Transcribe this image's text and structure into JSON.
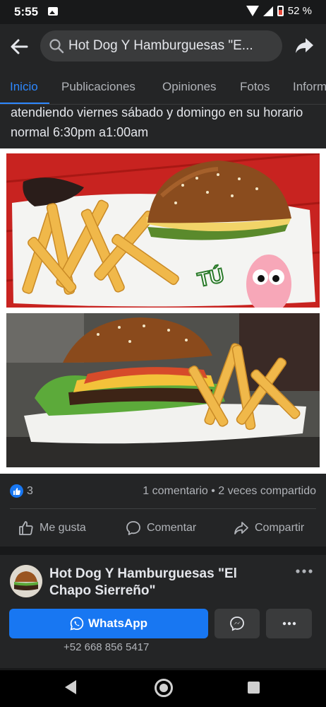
{
  "status_bar": {
    "time": "5:55",
    "battery": "52 %"
  },
  "header": {
    "search_text": "Hot Dog Y Hamburguesas \"E..."
  },
  "tabs": [
    {
      "label": "Inicio",
      "active": true
    },
    {
      "label": "Publicaciones",
      "active": false
    },
    {
      "label": "Opiniones",
      "active": false
    },
    {
      "label": "Fotos",
      "active": false
    },
    {
      "label": "Inform",
      "active": false
    }
  ],
  "post": {
    "text": "atendiendo viernes sábado y domingo en su horario normal 6:30pm a1:00am",
    "photo_1_caption": "TÚ",
    "reaction_count": "3",
    "engagement": "1 comentario • 2 veces compartido"
  },
  "actions": {
    "like": "Me gusta",
    "comment": "Comentar",
    "share": "Compartir"
  },
  "page_card": {
    "name": "Hot Dog Y Hamburguesas \"El Chapo Sierreño\"",
    "whatsapp_label": "WhatsApp",
    "phone": "+52 668 856 5417"
  },
  "colors": {
    "accent": "#2d88ff",
    "button_primary": "#1877f2",
    "background": "#242526",
    "photo_tray_red": "#c41f1c"
  },
  "icons": [
    "back-arrow-icon",
    "search-icon",
    "share-arrow-icon",
    "like-thumb-icon",
    "comment-bubble-icon",
    "share-icon",
    "whatsapp-icon",
    "messenger-icon",
    "more-horizontal-icon"
  ]
}
